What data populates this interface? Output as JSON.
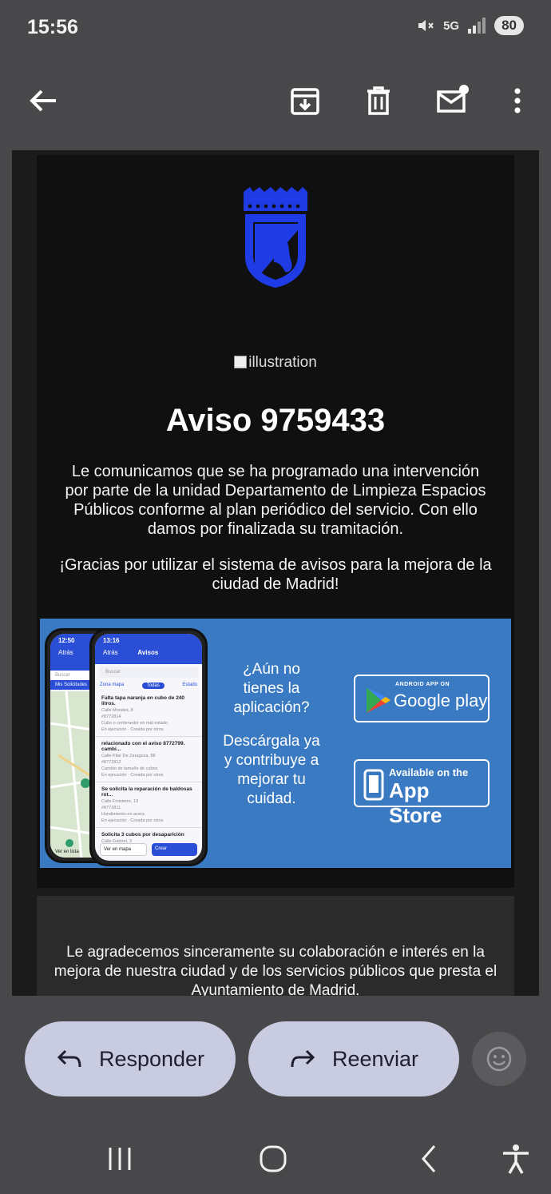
{
  "status": {
    "time": "15:56",
    "network": "5G",
    "battery": "80"
  },
  "toolbar": {
    "back_icon": "arrow-left-icon",
    "archive_icon": "archive-icon",
    "delete_icon": "trash-icon",
    "unread_icon": "mark-unread-icon",
    "more_icon": "more-vert-icon"
  },
  "email": {
    "broken_image_alt": "illustration",
    "title": "Aviso 9759433",
    "paragraph1": "Le comunicamos que se ha programado una intervención por parte de la unidad Departamento de Limpieza Espacios Públicos conforme al plan periódico del servicio. Con ello damos por finalizada su tramitación.",
    "paragraph2": "¡Gracias por utilizar el sistema de avisos para la mejora de la ciudad de Madrid!",
    "banner": {
      "question": "¿Aún no tienes la aplicación?",
      "cta": "Descárgala ya y contribuye a mejorar tu cuidad.",
      "google_small": "ANDROID APP ON",
      "google_big": "Google play",
      "apple_small": "Available on the",
      "apple_big": "App Store",
      "phone_back": {
        "time": "12:50",
        "back": "Atrás",
        "search": "Buscar",
        "tab": "Mis Solicitudes",
        "footer": "Ver en lista"
      },
      "phone_front": {
        "time": "13:16",
        "back": "Atrás",
        "title": "Avisos",
        "search": "Buscar",
        "filters": [
          "Zona mapa",
          "Todas",
          "Estado"
        ],
        "items": [
          {
            "title": "Falta tapa naranja en cubo de 240 litros.",
            "address": "Calle Morales, 8",
            "id": "#8772814",
            "detail": "Cubo o contenedor en mal estado",
            "status": "En ejecución",
            "creator": "Creada por otros"
          },
          {
            "title": "relacionado con el aviso 8772799. cambi...",
            "address": "Calle Pilar De Zaragoza, 88",
            "id": "#8772812",
            "detail": "Cambio de tamaño de cubos",
            "status": "En ejecución",
            "creator": "Creada por otros"
          },
          {
            "title": "Se solicita la reparación de baldosas rot...",
            "address": "Calle Finisterre, 19",
            "id": "#8772811",
            "detail": "Hundimiento en acera",
            "status": "En ejecución",
            "creator": "Creada por otros"
          },
          {
            "title": "Solicita 3 cubos por desaparición",
            "address": "Calle Gabriel, 3",
            "id": "",
            "detail": "",
            "status": "",
            "creator": ""
          }
        ],
        "map_button": "Ver en mapa",
        "create_button": "Crear"
      }
    },
    "thanks": "Le agradecemos sinceramente su colaboración e interés en la mejora de nuestra ciudad y de los servicios públicos que presta el Ayuntamiento de Madrid."
  },
  "actions": {
    "reply": "Responder",
    "forward": "Reenviar",
    "emoji_icon": "emoji-icon"
  },
  "colors": {
    "madrid_blue": "#1f3be6",
    "banner_blue": "#3a7ac2",
    "pill_bg": "#c9cbe1"
  }
}
